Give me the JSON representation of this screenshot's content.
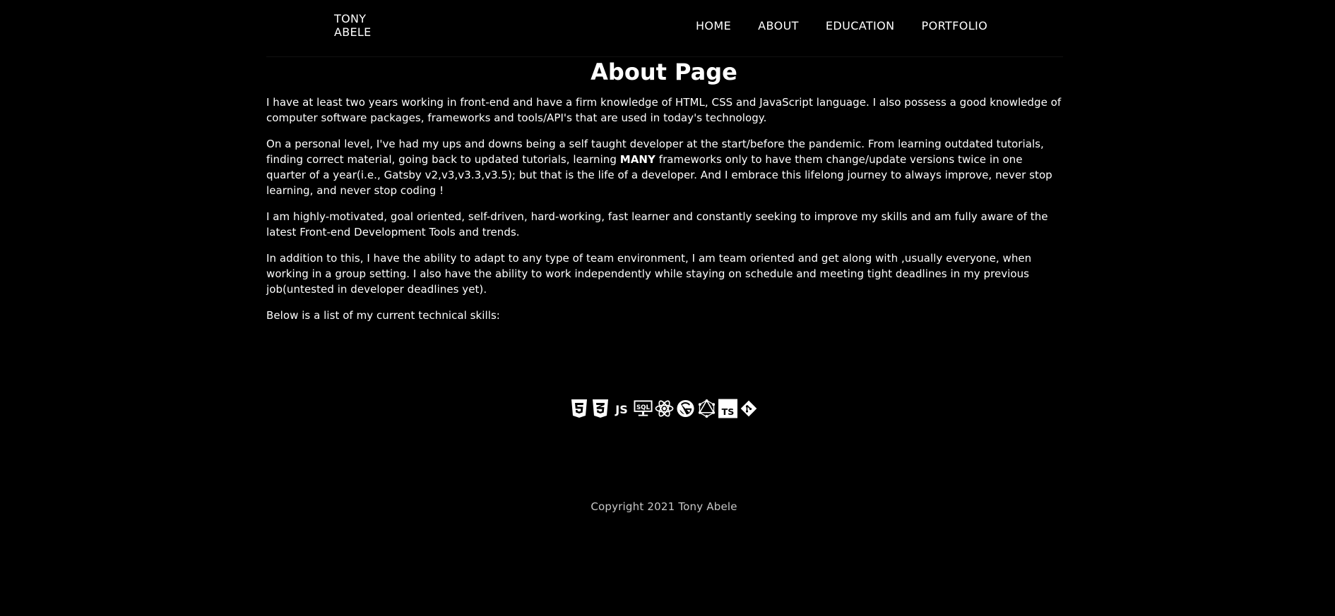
{
  "header": {
    "logo_line1": "TONY",
    "logo_line2": "ABELE",
    "nav": [
      {
        "label": "HOME"
      },
      {
        "label": "ABOUT"
      },
      {
        "label": "EDUCATION"
      },
      {
        "label": "PORTFOLIO"
      }
    ]
  },
  "main": {
    "title": "About Page",
    "p1": "I have at least two years working in front-end and have a firm knowledge of HTML, CSS and JavaScript language. I also possess a good knowledge of computer software packages, frameworks and tools/API's that are used in today's technology.",
    "p2_before": "On a personal level, I've had my ups and downs being a self taught developer at the start/before the pandemic. From learning outdated tutorials, finding correct material, going back to updated tutorials, learning ",
    "p2_bold": "MANY",
    "p2_after": " frameworks only to have them change/update versions twice in one quarter of a year(i.e., Gatsby v2,v3,v3.3,v3.5); but that is the life of a developer. And I embrace this lifelong journey to always improve, never stop learning, and never stop coding !",
    "p3": "I am highly-motivated, goal oriented, self-driven, hard-working, fast learner and constantly seeking to improve my skills and am fully aware of the latest Front-end Development Tools and trends.",
    "p4": "In addition to this, I have the ability to adapt to any type of team environment, I am team oriented and get along with ,usually everyone, when working in a group setting. I also have the ability to work independently while staying on schedule and meeting tight deadlines in my previous job(untested in developer deadlines yet).",
    "p5": "Below is a list of my current technical skills:"
  },
  "skills": [
    {
      "icon": "html5-icon"
    },
    {
      "icon": "css3-icon"
    },
    {
      "icon": "javascript-icon"
    },
    {
      "icon": "sql-icon",
      "text": "SQL"
    },
    {
      "icon": "react-icon"
    },
    {
      "icon": "gatsby-icon"
    },
    {
      "icon": "graphql-icon"
    },
    {
      "icon": "typescript-icon",
      "text": "TS"
    },
    {
      "icon": "git-icon"
    }
  ],
  "footer": {
    "copyright": "Copyright 2021 Tony Abele"
  }
}
